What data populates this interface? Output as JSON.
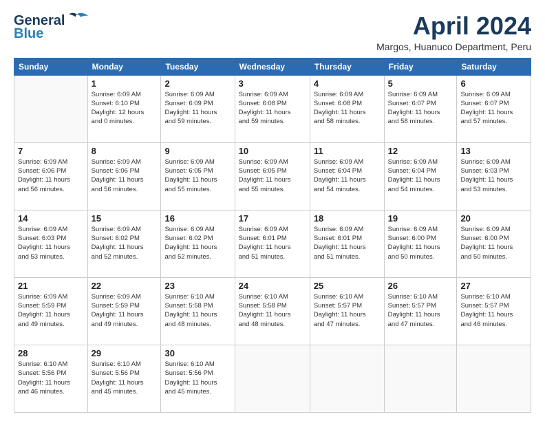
{
  "header": {
    "logo_line1": "General",
    "logo_line2": "Blue",
    "month_title": "April 2024",
    "location": "Margos, Huanuco Department, Peru"
  },
  "weekdays": [
    "Sunday",
    "Monday",
    "Tuesday",
    "Wednesday",
    "Thursday",
    "Friday",
    "Saturday"
  ],
  "weeks": [
    [
      {
        "day": "",
        "info": ""
      },
      {
        "day": "1",
        "info": "Sunrise: 6:09 AM\nSunset: 6:10 PM\nDaylight: 12 hours\nand 0 minutes."
      },
      {
        "day": "2",
        "info": "Sunrise: 6:09 AM\nSunset: 6:09 PM\nDaylight: 11 hours\nand 59 minutes."
      },
      {
        "day": "3",
        "info": "Sunrise: 6:09 AM\nSunset: 6:08 PM\nDaylight: 11 hours\nand 59 minutes."
      },
      {
        "day": "4",
        "info": "Sunrise: 6:09 AM\nSunset: 6:08 PM\nDaylight: 11 hours\nand 58 minutes."
      },
      {
        "day": "5",
        "info": "Sunrise: 6:09 AM\nSunset: 6:07 PM\nDaylight: 11 hours\nand 58 minutes."
      },
      {
        "day": "6",
        "info": "Sunrise: 6:09 AM\nSunset: 6:07 PM\nDaylight: 11 hours\nand 57 minutes."
      }
    ],
    [
      {
        "day": "7",
        "info": "Sunrise: 6:09 AM\nSunset: 6:06 PM\nDaylight: 11 hours\nand 56 minutes."
      },
      {
        "day": "8",
        "info": "Sunrise: 6:09 AM\nSunset: 6:06 PM\nDaylight: 11 hours\nand 56 minutes."
      },
      {
        "day": "9",
        "info": "Sunrise: 6:09 AM\nSunset: 6:05 PM\nDaylight: 11 hours\nand 55 minutes."
      },
      {
        "day": "10",
        "info": "Sunrise: 6:09 AM\nSunset: 6:05 PM\nDaylight: 11 hours\nand 55 minutes."
      },
      {
        "day": "11",
        "info": "Sunrise: 6:09 AM\nSunset: 6:04 PM\nDaylight: 11 hours\nand 54 minutes."
      },
      {
        "day": "12",
        "info": "Sunrise: 6:09 AM\nSunset: 6:04 PM\nDaylight: 11 hours\nand 54 minutes."
      },
      {
        "day": "13",
        "info": "Sunrise: 6:09 AM\nSunset: 6:03 PM\nDaylight: 11 hours\nand 53 minutes."
      }
    ],
    [
      {
        "day": "14",
        "info": "Sunrise: 6:09 AM\nSunset: 6:03 PM\nDaylight: 11 hours\nand 53 minutes."
      },
      {
        "day": "15",
        "info": "Sunrise: 6:09 AM\nSunset: 6:02 PM\nDaylight: 11 hours\nand 52 minutes."
      },
      {
        "day": "16",
        "info": "Sunrise: 6:09 AM\nSunset: 6:02 PM\nDaylight: 11 hours\nand 52 minutes."
      },
      {
        "day": "17",
        "info": "Sunrise: 6:09 AM\nSunset: 6:01 PM\nDaylight: 11 hours\nand 51 minutes."
      },
      {
        "day": "18",
        "info": "Sunrise: 6:09 AM\nSunset: 6:01 PM\nDaylight: 11 hours\nand 51 minutes."
      },
      {
        "day": "19",
        "info": "Sunrise: 6:09 AM\nSunset: 6:00 PM\nDaylight: 11 hours\nand 50 minutes."
      },
      {
        "day": "20",
        "info": "Sunrise: 6:09 AM\nSunset: 6:00 PM\nDaylight: 11 hours\nand 50 minutes."
      }
    ],
    [
      {
        "day": "21",
        "info": "Sunrise: 6:09 AM\nSunset: 5:59 PM\nDaylight: 11 hours\nand 49 minutes."
      },
      {
        "day": "22",
        "info": "Sunrise: 6:09 AM\nSunset: 5:59 PM\nDaylight: 11 hours\nand 49 minutes."
      },
      {
        "day": "23",
        "info": "Sunrise: 6:10 AM\nSunset: 5:58 PM\nDaylight: 11 hours\nand 48 minutes."
      },
      {
        "day": "24",
        "info": "Sunrise: 6:10 AM\nSunset: 5:58 PM\nDaylight: 11 hours\nand 48 minutes."
      },
      {
        "day": "25",
        "info": "Sunrise: 6:10 AM\nSunset: 5:57 PM\nDaylight: 11 hours\nand 47 minutes."
      },
      {
        "day": "26",
        "info": "Sunrise: 6:10 AM\nSunset: 5:57 PM\nDaylight: 11 hours\nand 47 minutes."
      },
      {
        "day": "27",
        "info": "Sunrise: 6:10 AM\nSunset: 5:57 PM\nDaylight: 11 hours\nand 46 minutes."
      }
    ],
    [
      {
        "day": "28",
        "info": "Sunrise: 6:10 AM\nSunset: 5:56 PM\nDaylight: 11 hours\nand 46 minutes."
      },
      {
        "day": "29",
        "info": "Sunrise: 6:10 AM\nSunset: 5:56 PM\nDaylight: 11 hours\nand 45 minutes."
      },
      {
        "day": "30",
        "info": "Sunrise: 6:10 AM\nSunset: 5:56 PM\nDaylight: 11 hours\nand 45 minutes."
      },
      {
        "day": "",
        "info": ""
      },
      {
        "day": "",
        "info": ""
      },
      {
        "day": "",
        "info": ""
      },
      {
        "day": "",
        "info": ""
      }
    ]
  ]
}
